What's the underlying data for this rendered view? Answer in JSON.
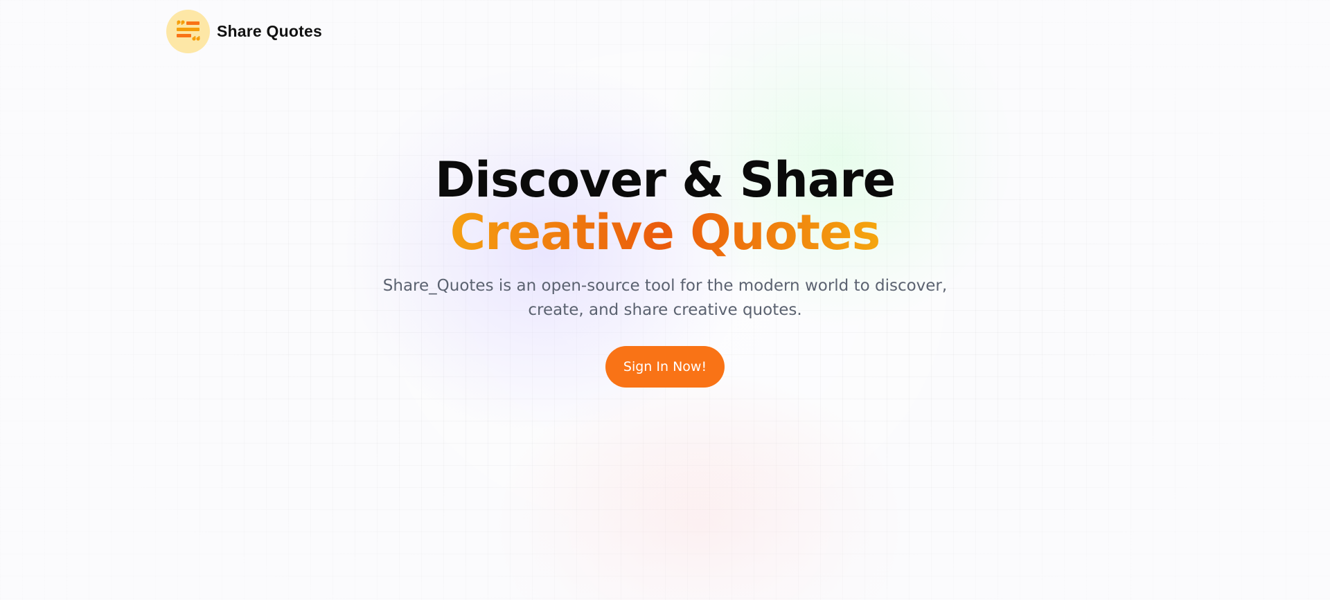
{
  "header": {
    "logo_icon": "quote-lines-icon",
    "brand_name": "Share Quotes"
  },
  "hero": {
    "headline_line1": "Discover & Share",
    "headline_line2": "Creative Quotes",
    "subtitle": "Share_Quotes is an open-source tool for the modern world to discover, create, and share creative quotes.",
    "cta_label": "Sign In Now!"
  },
  "colors": {
    "accent": "#f97316",
    "gradient_start": "#f5a011",
    "gradient_mid": "#ea5a0c",
    "gradient_end": "#f5a60f",
    "logo_badge": "#fde7a6",
    "headline": "#0a0a0a",
    "subtitle": "#5b6270"
  }
}
